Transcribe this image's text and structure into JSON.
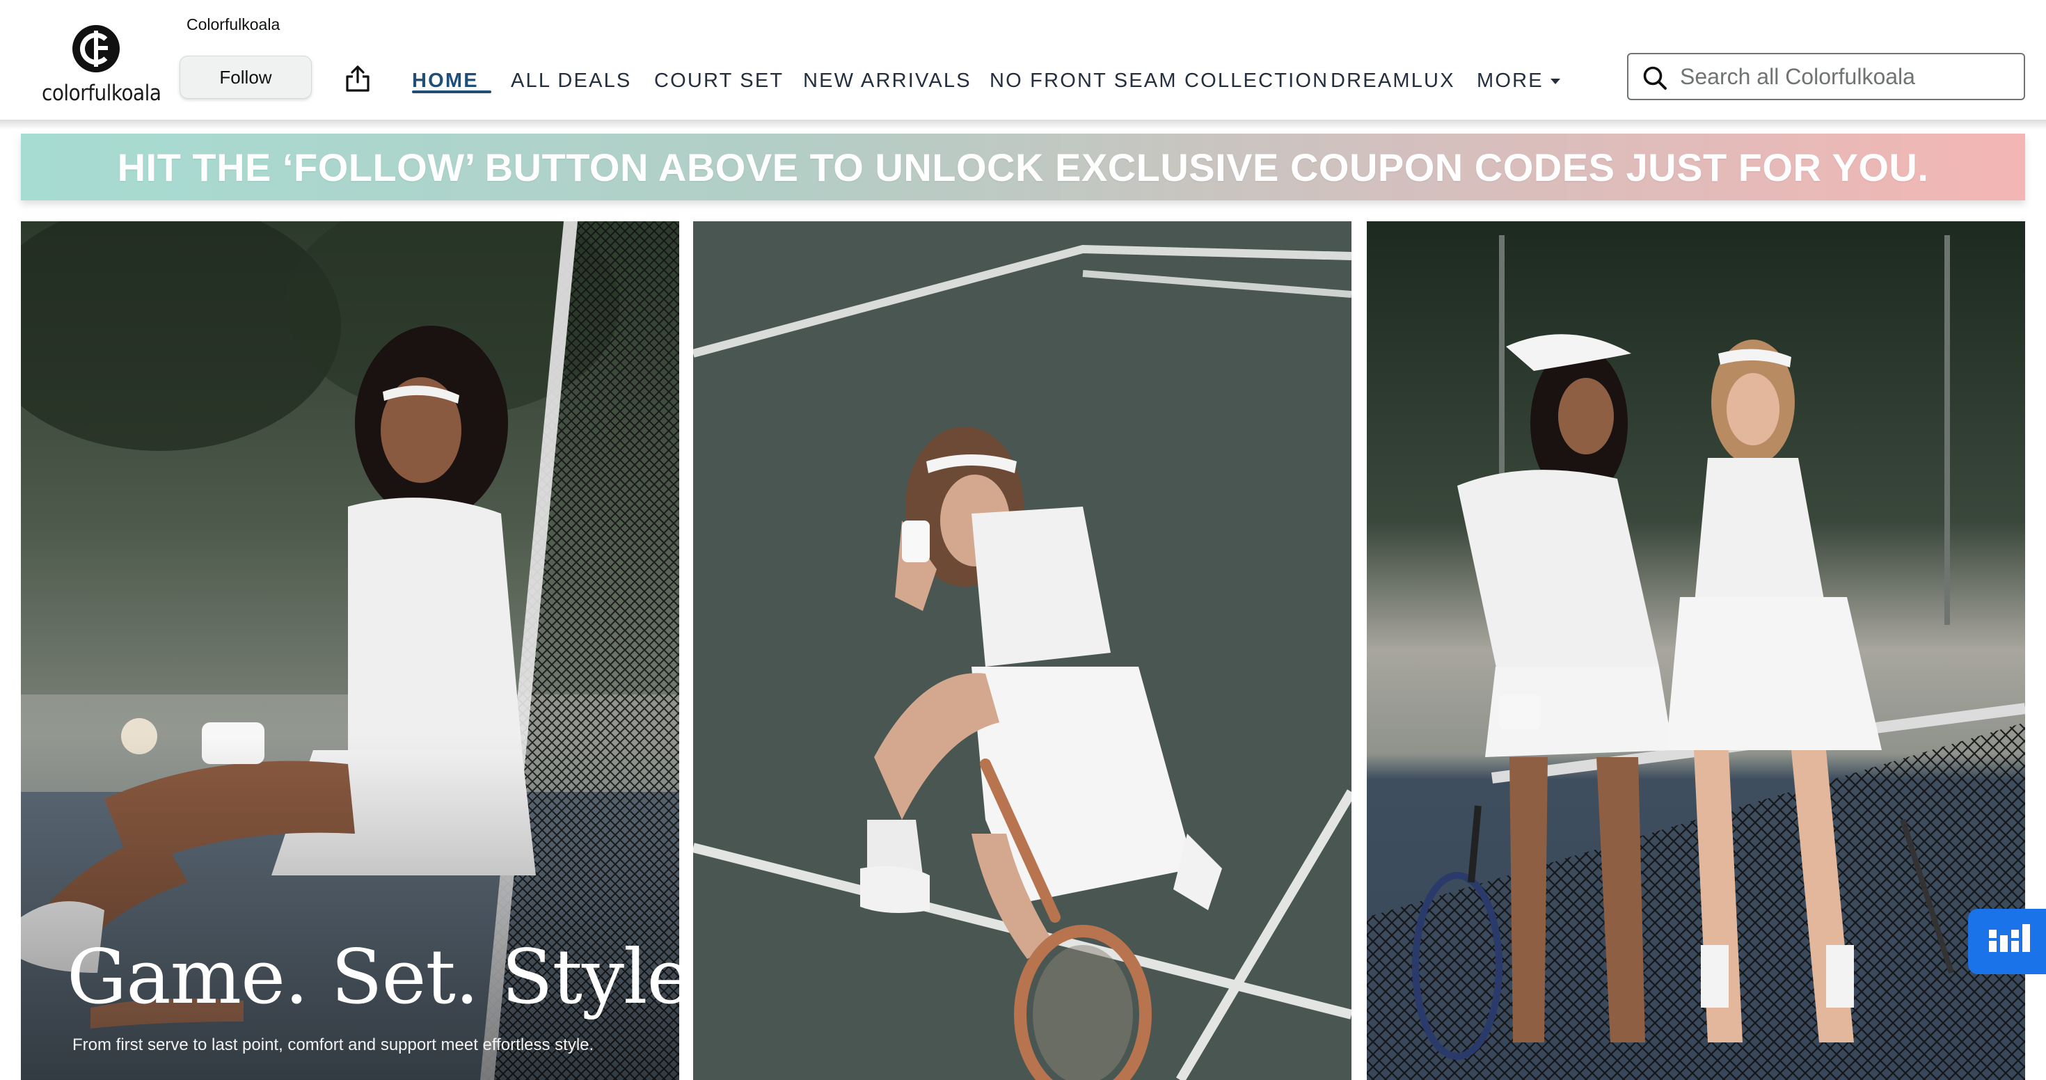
{
  "store": {
    "logo_text": "colorfulkoala",
    "brand_name": "Colorfulkoala",
    "follow_label": "Follow",
    "share_icon": "share-icon"
  },
  "nav": {
    "items": [
      {
        "label": "HOME",
        "active": true
      },
      {
        "label": "ALL DEALS",
        "active": false
      },
      {
        "label": "COURT SET",
        "active": false
      },
      {
        "label": "NEW ARRIVALS",
        "active": false
      },
      {
        "label": "NO FRONT SEAM COLLECTION",
        "active": false
      },
      {
        "label": "DREAMLUX",
        "active": false
      },
      {
        "label": "MORE",
        "active": false
      }
    ]
  },
  "search": {
    "placeholder": "Search all Colorfulkoala",
    "value": "",
    "icon": "search-icon"
  },
  "banner": {
    "text": "HIT THE ‘FOLLOW’ BUTTON ABOVE TO UNLOCK EXCLUSIVE COUPON CODES JUST FOR YOU.",
    "gradient_start": "#a6dcd2",
    "gradient_end": "#f3b6b4"
  },
  "hero": {
    "title": "Game. Set. Style.",
    "subtitle": "From first serve to last point, comfort and support meet effortless style."
  },
  "tiles": [
    {
      "image": "model-seated-by-net-photo"
    },
    {
      "image": "model-kneeling-with-racket-photo"
    },
    {
      "image": "two-models-at-net-photo"
    }
  ],
  "widget": {
    "icon": "bar-chart-icon"
  },
  "colors": {
    "nav_active": "#1f4e79",
    "nav_text": "#232f3e",
    "widget_blue": "#1a73e8"
  }
}
